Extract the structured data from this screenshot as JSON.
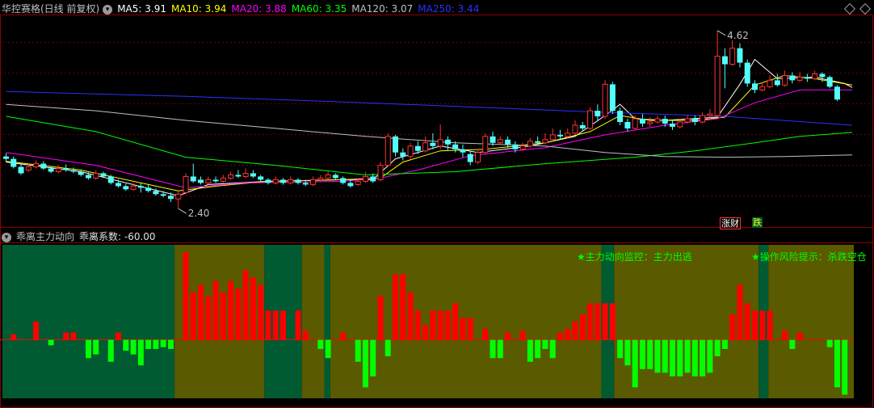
{
  "header": {
    "stock_name": "华控赛格(日线 前复权)",
    "ma": [
      {
        "label": "MA5: 3.91",
        "color": "#ffffff"
      },
      {
        "label": "MA10: 3.94",
        "color": "#ffff00"
      },
      {
        "label": "MA20: 3.88",
        "color": "#ff00ff"
      },
      {
        "label": "MA60: 3.35",
        "color": "#00ff00"
      },
      {
        "label": "MA120: 3.07",
        "color": "#c0c0c0"
      },
      {
        "label": "MA250: 3.44",
        "color": "#2f2fff"
      }
    ]
  },
  "indicator": {
    "title": "乖离主力动向",
    "coef": "乖离系数: -60.00",
    "alert1": "★主力动向监控：主力出逃",
    "alert2": "★操作风险提示：杀跌空仓"
  },
  "markers": {
    "tag1": "涨财",
    "tag2": "跌"
  },
  "colors": {
    "up": "#ff3232",
    "down": "#54fcfc",
    "bg_green": "#005a32",
    "bg_olive": "#5a5a00",
    "bar_up": "#ff0000",
    "bar_down": "#00ff00"
  },
  "chart_data": {
    "type": "candlestick",
    "price_range": [
      2.2,
      4.8
    ],
    "high_label": "4.62",
    "low_label": "2.40",
    "candles": [
      [
        3.05,
        3.02,
        3.09,
        2.98
      ],
      [
        3.02,
        2.92,
        3.05,
        2.9
      ],
      [
        2.92,
        2.84,
        2.95,
        2.82
      ],
      [
        2.88,
        2.92,
        2.96,
        2.86
      ],
      [
        2.92,
        2.96,
        3.0,
        2.9
      ],
      [
        2.96,
        2.9,
        2.99,
        2.88
      ],
      [
        2.9,
        2.86,
        2.93,
        2.84
      ],
      [
        2.86,
        2.9,
        2.94,
        2.84
      ],
      [
        2.9,
        2.88,
        2.95,
        2.86
      ],
      [
        2.88,
        2.86,
        2.91,
        2.84
      ],
      [
        2.86,
        2.82,
        2.88,
        2.8
      ],
      [
        2.82,
        2.78,
        2.85,
        2.76
      ],
      [
        2.78,
        2.84,
        2.88,
        2.76
      ],
      [
        2.84,
        2.8,
        2.86,
        2.78
      ],
      [
        2.8,
        2.72,
        2.82,
        2.7
      ],
      [
        2.72,
        2.68,
        2.76,
        2.66
      ],
      [
        2.68,
        2.64,
        2.71,
        2.62
      ],
      [
        2.64,
        2.68,
        2.72,
        2.62
      ],
      [
        2.68,
        2.66,
        2.72,
        2.6
      ],
      [
        2.66,
        2.62,
        2.7,
        2.6
      ],
      [
        2.62,
        2.58,
        2.65,
        2.56
      ],
      [
        2.58,
        2.56,
        2.62,
        2.54
      ],
      [
        2.56,
        2.52,
        2.6,
        2.48
      ],
      [
        2.52,
        2.58,
        2.62,
        2.4
      ],
      [
        2.6,
        2.8,
        2.84,
        2.58
      ],
      [
        2.8,
        2.74,
        2.96,
        2.72
      ],
      [
        2.76,
        2.72,
        2.8,
        2.7
      ],
      [
        2.72,
        2.76,
        2.8,
        2.7
      ],
      [
        2.76,
        2.74,
        2.8,
        2.72
      ],
      [
        2.74,
        2.78,
        2.82,
        2.72
      ],
      [
        2.78,
        2.82,
        2.86,
        2.76
      ],
      [
        2.82,
        2.8,
        2.88,
        2.78
      ],
      [
        2.8,
        2.84,
        2.9,
        2.78
      ],
      [
        2.84,
        2.8,
        2.88,
        2.78
      ],
      [
        2.8,
        2.76,
        2.82,
        2.74
      ],
      [
        2.76,
        2.72,
        2.78,
        2.7
      ],
      [
        2.72,
        2.76,
        2.8,
        2.7
      ],
      [
        2.76,
        2.72,
        2.78,
        2.7
      ],
      [
        2.72,
        2.76,
        2.8,
        2.7
      ],
      [
        2.76,
        2.72,
        2.78,
        2.7
      ],
      [
        2.72,
        2.7,
        2.76,
        2.68
      ],
      [
        2.7,
        2.76,
        2.8,
        2.68
      ],
      [
        2.76,
        2.78,
        2.82,
        2.74
      ],
      [
        2.78,
        2.82,
        2.86,
        2.76
      ],
      [
        2.82,
        2.78,
        2.84,
        2.76
      ],
      [
        2.78,
        2.72,
        2.8,
        2.7
      ],
      [
        2.72,
        2.68,
        2.76,
        2.66
      ],
      [
        2.7,
        2.74,
        2.78,
        2.68
      ],
      [
        2.74,
        2.8,
        2.86,
        2.72
      ],
      [
        2.8,
        2.74,
        2.84,
        2.72
      ],
      [
        2.76,
        2.94,
        2.98,
        2.74
      ],
      [
        2.94,
        3.3,
        3.34,
        2.92
      ],
      [
        3.3,
        3.1,
        3.32,
        3.05
      ],
      [
        3.1,
        3.05,
        3.15,
        3.0
      ],
      [
        3.05,
        3.18,
        3.22,
        3.02
      ],
      [
        3.18,
        3.12,
        3.24,
        3.08
      ],
      [
        3.12,
        3.22,
        3.3,
        3.1
      ],
      [
        3.22,
        3.18,
        3.34,
        3.14
      ],
      [
        3.18,
        3.26,
        3.45,
        3.14
      ],
      [
        3.26,
        3.2,
        3.3,
        3.12
      ],
      [
        3.2,
        3.14,
        3.24,
        3.1
      ],
      [
        3.14,
        3.1,
        3.2,
        3.04
      ],
      [
        3.08,
        2.98,
        3.12,
        2.94
      ],
      [
        2.98,
        3.1,
        3.14,
        2.96
      ],
      [
        3.1,
        3.3,
        3.34,
        3.08
      ],
      [
        3.3,
        3.22,
        3.36,
        3.18
      ],
      [
        3.22,
        3.26,
        3.3,
        3.2
      ],
      [
        3.26,
        3.2,
        3.3,
        3.16
      ],
      [
        3.2,
        3.14,
        3.24,
        3.1
      ],
      [
        3.14,
        3.18,
        3.22,
        3.12
      ],
      [
        3.18,
        3.24,
        3.28,
        3.16
      ],
      [
        3.24,
        3.22,
        3.3,
        3.2
      ],
      [
        3.22,
        3.26,
        3.34,
        3.2
      ],
      [
        3.26,
        3.32,
        3.4,
        3.24
      ],
      [
        3.32,
        3.3,
        3.38,
        3.26
      ],
      [
        3.3,
        3.34,
        3.4,
        3.28
      ],
      [
        3.34,
        3.44,
        3.5,
        3.32
      ],
      [
        3.44,
        3.4,
        3.48,
        3.36
      ],
      [
        3.4,
        3.62,
        3.66,
        3.38
      ],
      [
        3.62,
        3.55,
        3.7,
        3.5
      ],
      [
        3.55,
        3.95,
        4.0,
        3.52
      ],
      [
        3.95,
        3.62,
        3.98,
        3.58
      ],
      [
        3.62,
        3.48,
        3.66,
        3.44
      ],
      [
        3.48,
        3.4,
        3.52,
        3.36
      ],
      [
        3.4,
        3.52,
        3.56,
        3.38
      ],
      [
        3.52,
        3.46,
        3.58,
        3.42
      ],
      [
        3.46,
        3.48,
        3.54,
        3.42
      ],
      [
        3.48,
        3.52,
        3.56,
        3.46
      ],
      [
        3.52,
        3.46,
        3.56,
        3.42
      ],
      [
        3.46,
        3.42,
        3.5,
        3.38
      ],
      [
        3.42,
        3.48,
        3.52,
        3.4
      ],
      [
        3.48,
        3.52,
        3.56,
        3.46
      ],
      [
        3.52,
        3.48,
        3.56,
        3.44
      ],
      [
        3.48,
        3.56,
        3.6,
        3.46
      ],
      [
        3.56,
        3.58,
        3.64,
        3.52
      ],
      [
        3.56,
        4.3,
        4.62,
        3.54
      ],
      [
        4.3,
        4.2,
        4.4,
        3.9
      ],
      [
        4.2,
        4.4,
        4.5,
        4.18
      ],
      [
        4.4,
        4.22,
        4.46,
        4.16
      ],
      [
        4.22,
        3.96,
        4.26,
        3.92
      ],
      [
        3.96,
        3.88,
        4.0,
        3.84
      ],
      [
        3.88,
        3.92,
        3.98,
        3.86
      ],
      [
        3.92,
        4.0,
        4.06,
        3.9
      ],
      [
        4.0,
        3.94,
        4.08,
        3.92
      ],
      [
        3.94,
        4.06,
        4.12,
        3.92
      ],
      [
        4.06,
        4.0,
        4.1,
        3.96
      ],
      [
        4.0,
        4.04,
        4.1,
        3.98
      ],
      [
        4.04,
        4.02,
        4.08,
        3.98
      ],
      [
        4.02,
        4.08,
        4.12,
        4.0
      ],
      [
        4.08,
        4.04,
        4.1,
        3.98
      ],
      [
        4.04,
        3.92,
        4.06,
        3.9
      ],
      [
        3.92,
        3.76,
        3.94,
        3.74
      ]
    ],
    "ma_series": [
      {
        "name": "MA5",
        "color": "#ffffff",
        "points": [
          [
            0,
            2.98
          ],
          [
            10,
            2.86
          ],
          [
            23,
            2.56
          ],
          [
            27,
            2.7
          ],
          [
            35,
            2.74
          ],
          [
            45,
            2.76
          ],
          [
            49,
            2.76
          ],
          [
            52,
            3.02
          ],
          [
            58,
            3.18
          ],
          [
            63,
            3.1
          ],
          [
            70,
            3.18
          ],
          [
            76,
            3.3
          ],
          [
            80,
            3.56
          ],
          [
            82,
            3.7
          ],
          [
            84,
            3.52
          ],
          [
            88,
            3.5
          ],
          [
            95,
            3.54
          ],
          [
            98,
            3.95
          ],
          [
            100,
            4.26
          ],
          [
            103,
            4.02
          ],
          [
            108,
            4.04
          ],
          [
            112,
            3.96
          ],
          [
            113,
            3.91
          ]
        ]
      },
      {
        "name": "MA10",
        "color": "#ffff00",
        "points": [
          [
            0,
            2.99
          ],
          [
            10,
            2.88
          ],
          [
            23,
            2.62
          ],
          [
            28,
            2.68
          ],
          [
            35,
            2.74
          ],
          [
            45,
            2.76
          ],
          [
            50,
            2.78
          ],
          [
            53,
            2.98
          ],
          [
            58,
            3.12
          ],
          [
            64,
            3.14
          ],
          [
            72,
            3.22
          ],
          [
            78,
            3.36
          ],
          [
            82,
            3.56
          ],
          [
            86,
            3.5
          ],
          [
            92,
            3.5
          ],
          [
            96,
            3.54
          ],
          [
            100,
            3.94
          ],
          [
            104,
            4.06
          ],
          [
            108,
            4.02
          ],
          [
            113,
            3.94
          ]
        ]
      },
      {
        "name": "MA20",
        "color": "#ff00ff",
        "points": [
          [
            0,
            3.1
          ],
          [
            12,
            2.94
          ],
          [
            24,
            2.66
          ],
          [
            32,
            2.72
          ],
          [
            45,
            2.74
          ],
          [
            50,
            2.78
          ],
          [
            55,
            2.88
          ],
          [
            62,
            3.06
          ],
          [
            72,
            3.16
          ],
          [
            80,
            3.32
          ],
          [
            88,
            3.44
          ],
          [
            95,
            3.52
          ],
          [
            100,
            3.72
          ],
          [
            106,
            3.88
          ],
          [
            113,
            3.88
          ]
        ]
      },
      {
        "name": "MA60",
        "color": "#00ff00",
        "points": [
          [
            0,
            3.55
          ],
          [
            12,
            3.36
          ],
          [
            24,
            3.04
          ],
          [
            36,
            2.94
          ],
          [
            48,
            2.82
          ],
          [
            60,
            2.86
          ],
          [
            72,
            2.96
          ],
          [
            84,
            3.04
          ],
          [
            92,
            3.12
          ],
          [
            100,
            3.22
          ],
          [
            106,
            3.3
          ],
          [
            113,
            3.35
          ]
        ]
      },
      {
        "name": "MA120",
        "color": "#c0c0c0",
        "points": [
          [
            0,
            3.7
          ],
          [
            12,
            3.62
          ],
          [
            24,
            3.5
          ],
          [
            36,
            3.4
          ],
          [
            48,
            3.3
          ],
          [
            60,
            3.22
          ],
          [
            72,
            3.18
          ],
          [
            80,
            3.1
          ],
          [
            88,
            3.05
          ],
          [
            96,
            3.04
          ],
          [
            104,
            3.05
          ],
          [
            113,
            3.07
          ]
        ]
      },
      {
        "name": "MA250",
        "color": "#2f2fff",
        "points": [
          [
            0,
            3.86
          ],
          [
            24,
            3.8
          ],
          [
            48,
            3.72
          ],
          [
            64,
            3.66
          ],
          [
            80,
            3.6
          ],
          [
            96,
            3.55
          ],
          [
            113,
            3.44
          ]
        ]
      }
    ],
    "sub_range": [
      -3.2,
      5.2
    ],
    "sub_bars": [
      0,
      0.3,
      0,
      0,
      1.0,
      0,
      -0.3,
      0,
      0.4,
      0.4,
      0,
      -1.0,
      -0.8,
      0,
      -1.2,
      0.4,
      -0.6,
      -0.8,
      -1.4,
      -0.5,
      -0.5,
      -0.4,
      -0.5,
      0,
      4.8,
      2.6,
      3.0,
      2.4,
      3.2,
      2.6,
      3.2,
      2.8,
      3.8,
      3.4,
      3.0,
      1.6,
      1.6,
      1.6,
      0,
      1.6,
      0.5,
      0,
      -0.5,
      -1.0,
      0,
      0.4,
      0,
      -1.2,
      -2.6,
      -2.0,
      2.4,
      -0.9,
      3.6,
      3.6,
      2.6,
      1.6,
      0.8,
      1.6,
      1.6,
      1.6,
      2.0,
      1.2,
      1.2,
      0,
      0.6,
      -1.0,
      -1.0,
      0.4,
      0,
      0.5,
      -1.2,
      -1.0,
      -0.5,
      -1.0,
      0.4,
      0.6,
      1.0,
      1.4,
      2.0,
      2.0,
      2.0,
      2.0,
      -1.0,
      -1.4,
      -2.6,
      -1.6,
      -1.6,
      -1.8,
      -1.8,
      -2.0,
      -2.0,
      -1.8,
      -2.0,
      -2.0,
      -1.8,
      -0.9,
      -0.5,
      1.4,
      3.0,
      2.0,
      1.6,
      1.6,
      1.6,
      0,
      0.5,
      -0.5,
      0.4,
      0,
      0,
      0,
      -0.4,
      -2.6,
      -3.0
    ],
    "sub_bg": [
      {
        "from": -0.5,
        "to": 22.5,
        "color": "green"
      },
      {
        "from": 22.5,
        "to": 34.5,
        "color": "olive"
      },
      {
        "from": 34.5,
        "to": 39.5,
        "color": "green"
      },
      {
        "from": 39.5,
        "to": 42.5,
        "color": "olive"
      },
      {
        "from": 42.5,
        "to": 43.3,
        "color": "green"
      },
      {
        "from": 43.3,
        "to": 79.5,
        "color": "olive"
      },
      {
        "from": 79.5,
        "to": 81.2,
        "color": "green"
      },
      {
        "from": 81.2,
        "to": 100.5,
        "color": "olive"
      },
      {
        "from": 100.5,
        "to": 101.8,
        "color": "green"
      },
      {
        "from": 101.8,
        "to": 113.5,
        "color": "olive"
      }
    ]
  }
}
